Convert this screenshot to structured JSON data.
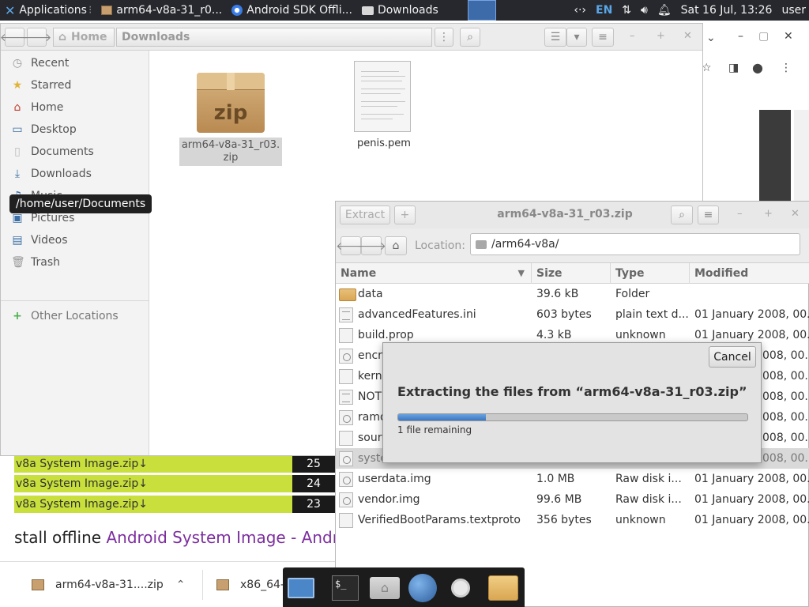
{
  "top_panel": {
    "applications": "Applications",
    "tasks": [
      {
        "label": "arm64-v8a-31_r0...",
        "icon": "archive-icon"
      },
      {
        "label": "Android SDK Offli...",
        "icon": "chrome-icon"
      },
      {
        "label": "Downloads",
        "icon": "folder-icon"
      }
    ],
    "keyboard_layout": "EN",
    "clock": "Sat 16 Jul, 13:26",
    "user": "user"
  },
  "browser": {
    "downloads_list": [
      {
        "name": "v8a System Image.zip↓",
        "count": "25"
      },
      {
        "name": "v8a System Image.zip↓",
        "count": "24"
      },
      {
        "name": "v8a System Image.zip↓",
        "count": "23"
      }
    ],
    "heading_prefix": "stall offline ",
    "heading_highlight": "Android System Image - Andro",
    "shelf": [
      {
        "label": "arm64-v8a-31....zip"
      },
      {
        "label": "x86_64-"
      }
    ]
  },
  "file_manager": {
    "nav": {
      "home_crumb": "Home",
      "current_crumb": "Downloads"
    },
    "sidebar": [
      {
        "label": "Recent",
        "icon": "clock-icon"
      },
      {
        "label": "Starred",
        "icon": "star-icon"
      },
      {
        "label": "Home",
        "icon": "home-icon"
      },
      {
        "label": "Desktop",
        "icon": "desktop-icon"
      },
      {
        "label": "Documents",
        "icon": "document-icon"
      },
      {
        "label": "Downloads",
        "icon": "download-icon"
      },
      {
        "label": "Music",
        "icon": "music-icon"
      },
      {
        "label": "Pictures",
        "icon": "picture-icon"
      },
      {
        "label": "Videos",
        "icon": "video-icon"
      },
      {
        "label": "Trash",
        "icon": "trash-icon"
      },
      {
        "label": "Other Locations",
        "icon": "plus-icon"
      }
    ],
    "tooltip": "/home/user/Documents",
    "files": [
      {
        "name_line1": "arm64-v8a-31_r03.",
        "name_line2": "zip",
        "icon_text": "zip"
      },
      {
        "name": "penis.pem"
      }
    ]
  },
  "archive_manager": {
    "title": "arm64-v8a-31_r03.zip",
    "extract_label": "Extract",
    "location_label": "Location:",
    "location_value": "/arm64-v8a/",
    "columns": {
      "name": "Name",
      "size": "Size",
      "type": "Type",
      "modified": "Modified"
    },
    "rows": [
      {
        "name": "data",
        "size": "39.6 kB",
        "type": "Folder",
        "modified": "",
        "icon": "folder-icon"
      },
      {
        "name": "advancedFeatures.ini",
        "size": "603 bytes",
        "type": "plain text d...",
        "modified": "01 January 2008, 00...",
        "icon": "text-file-icon"
      },
      {
        "name": "build.prop",
        "size": "4.3 kB",
        "type": "unknown",
        "modified": "01 January 2008, 00...",
        "icon": "file-icon"
      },
      {
        "name": "encry",
        "size": "",
        "type": "",
        "modified": "008, 00...",
        "icon": "disk-image-icon"
      },
      {
        "name": "kerne",
        "size": "",
        "type": "",
        "modified": "008, 00...",
        "icon": "file-icon"
      },
      {
        "name": "NOTI",
        "size": "",
        "type": "",
        "modified": "008, 00...",
        "icon": "text-file-icon"
      },
      {
        "name": "ramd",
        "size": "",
        "type": "",
        "modified": "008, 00...",
        "icon": "disk-image-icon"
      },
      {
        "name": "sourc",
        "size": "",
        "type": "",
        "modified": "008, 00...",
        "icon": "file-icon"
      },
      {
        "name": "syste",
        "size": "",
        "type": "",
        "modified": "008, 00...",
        "icon": "disk-image-icon"
      },
      {
        "name": "userdata.img",
        "size": "1.0 MB",
        "type": "Raw disk i...",
        "modified": "01 January 2008, 00...",
        "icon": "disk-image-icon"
      },
      {
        "name": "vendor.img",
        "size": "99.6 MB",
        "type": "Raw disk i...",
        "modified": "01 January 2008, 00...",
        "icon": "disk-image-icon"
      },
      {
        "name": "VerifiedBootParams.textproto",
        "size": "356 bytes",
        "type": "unknown",
        "modified": "01 January 2008, 00...",
        "icon": "file-icon"
      }
    ],
    "selected_row": 8
  },
  "progress_dialog": {
    "cancel_label": "Cancel",
    "title": "Extracting the files from “arm64-v8a-31_r03.zip”",
    "remaining": "1 file remaining",
    "progress_fraction": 0.25
  },
  "dock": [
    {
      "icon": "show-desktop-icon"
    },
    {
      "icon": "terminal-icon"
    },
    {
      "icon": "home-folder-icon"
    },
    {
      "icon": "web-browser-icon"
    },
    {
      "icon": "search-icon"
    },
    {
      "icon": "folder-icon"
    }
  ],
  "colors": {
    "accent": "#3b78c0",
    "download_row": "#c8df3c",
    "link": "#7c2e9e",
    "panel": "#26282d"
  }
}
